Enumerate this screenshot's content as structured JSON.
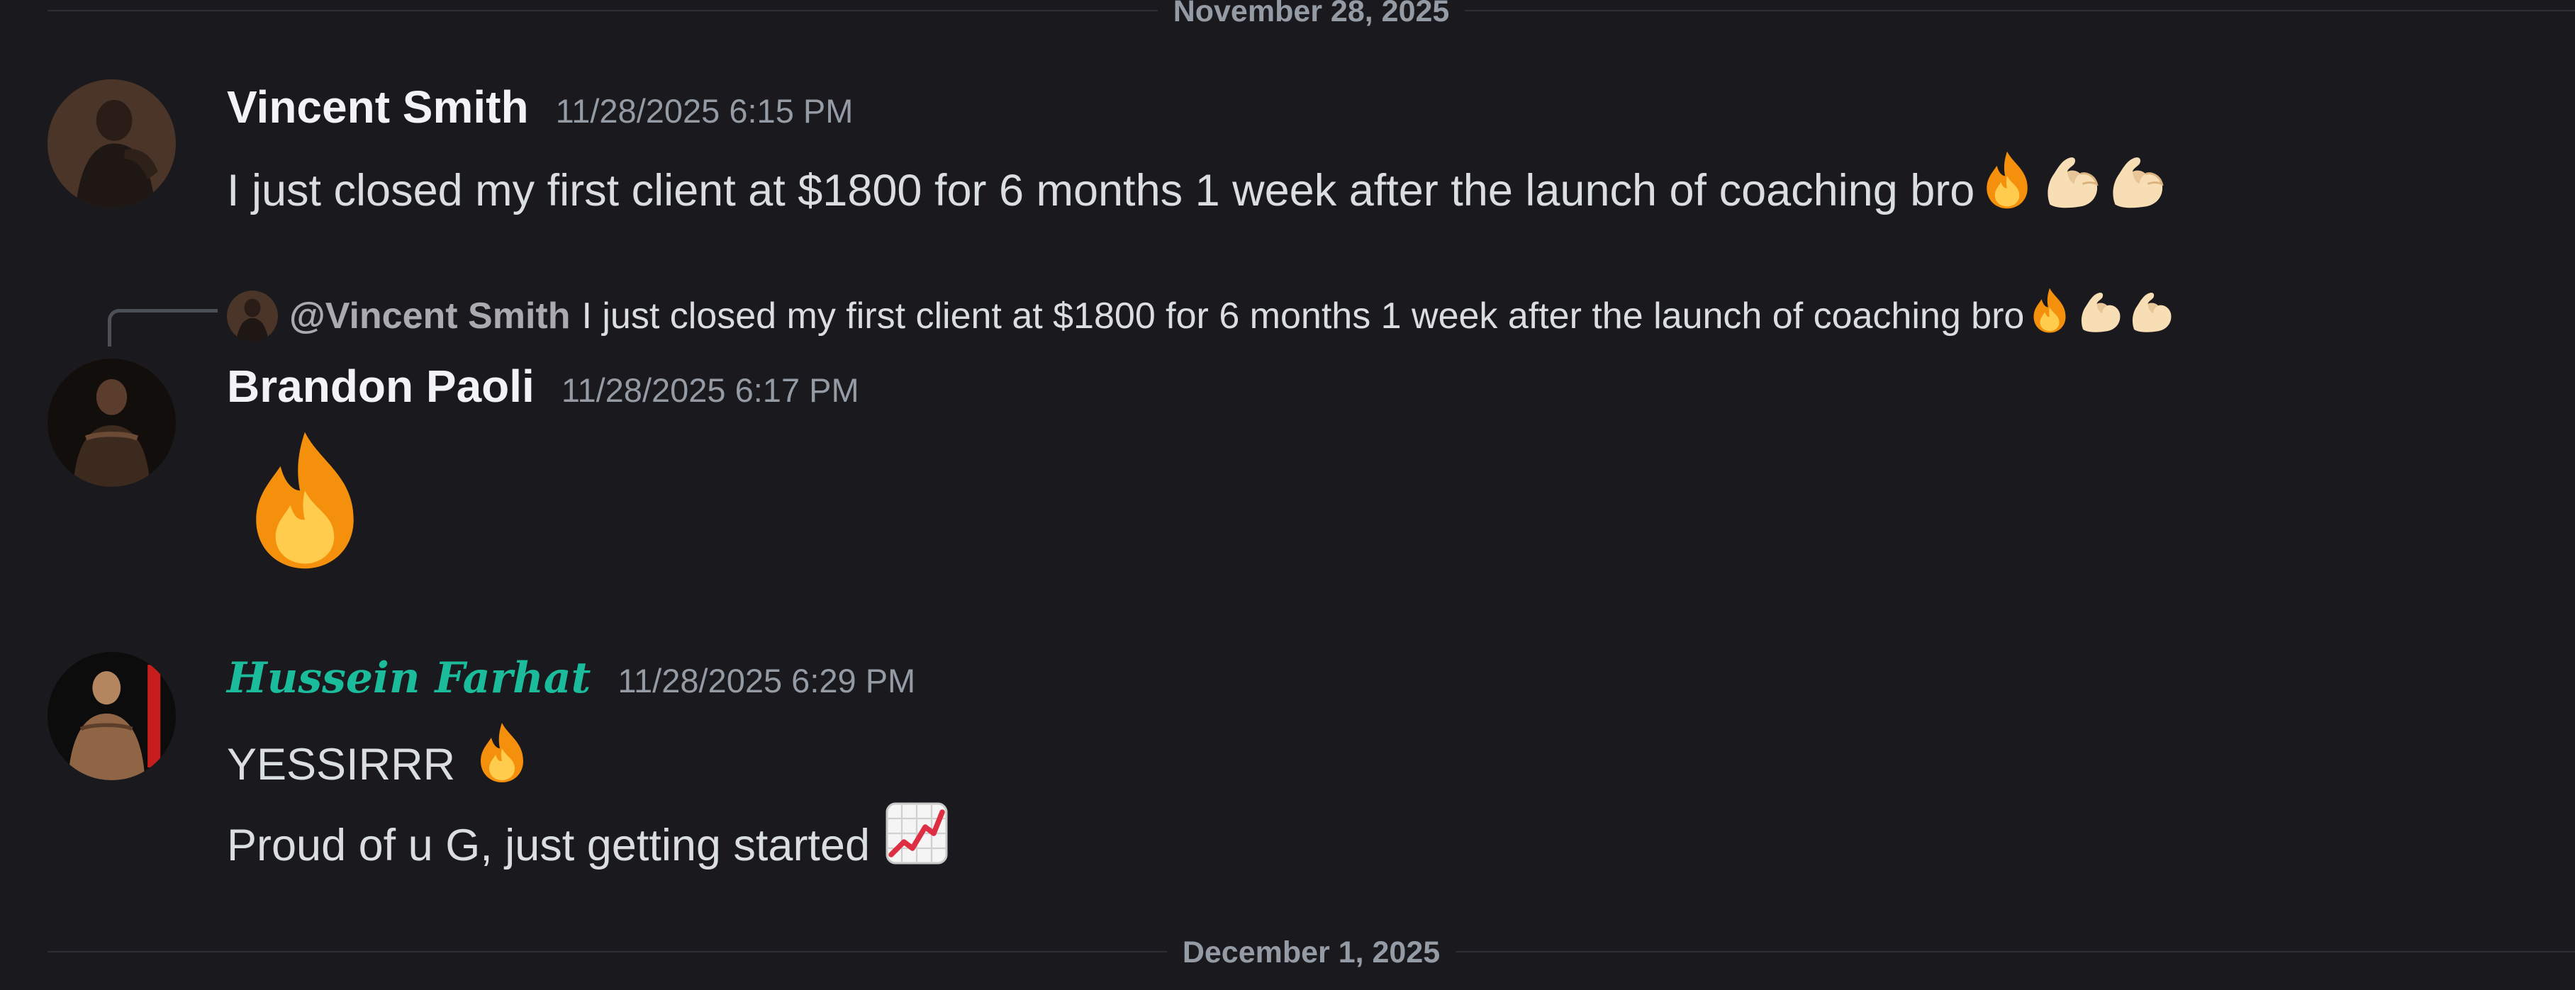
{
  "dividers": {
    "top": "November 28, 2025",
    "bottom": "December 1, 2025"
  },
  "messages": [
    {
      "author": "Vincent Smith",
      "timestamp": "11/28/2025 6:15 PM",
      "text": "I just closed my first client at $1800 for 6 months 1 week after the launch of coaching bro",
      "emojis": [
        "fire-emoji",
        "flexed-biceps-emoji",
        "flexed-biceps-emoji"
      ]
    },
    {
      "reply": {
        "author": "@Vincent Smith",
        "text": "I just closed my first client at $1800 for 6 months 1 week after the launch of coaching bro",
        "emojis": [
          "fire-emoji",
          "flexed-biceps-emoji",
          "flexed-biceps-emoji"
        ]
      },
      "author": "Brandon Paoli",
      "timestamp": "11/28/2025 6:17 PM",
      "emojis": [
        "fire-emoji"
      ]
    },
    {
      "author": "Hussein Farhat",
      "author_color": "#1abc9c",
      "timestamp": "11/28/2025 6:29 PM",
      "lines": [
        {
          "text": "YESSIRRR",
          "emoji": "fire-emoji"
        },
        {
          "text": "Proud of u G, just getting started",
          "emoji": "chart-increasing-emoji"
        }
      ]
    }
  ]
}
